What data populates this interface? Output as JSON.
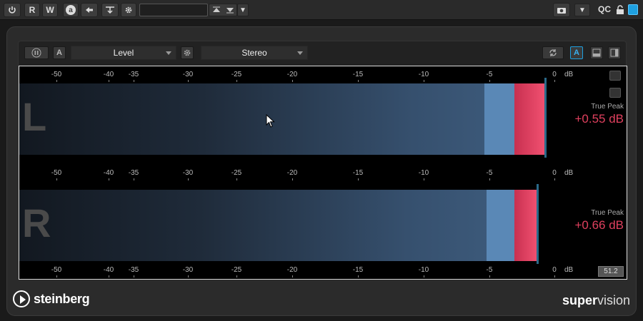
{
  "host_toolbar": {
    "power_icon": "power-icon",
    "read_label": "R",
    "write_label": "W",
    "automation_icon": "a",
    "preset_value": "",
    "qc_label": "QC"
  },
  "controls": {
    "mode_select": "Level",
    "channel_select": "Stereo",
    "auto_label": "A",
    "auto_right_label": "A"
  },
  "scale": {
    "ticks": [
      "-50",
      "-40",
      "-35",
      "-30",
      "-25",
      "-20",
      "-15",
      "-10",
      "-5",
      "0"
    ],
    "unit": "dB"
  },
  "channels": [
    {
      "letter": "L",
      "true_peak_label": "True Peak",
      "true_peak_value": "+0.55 dB",
      "level_fraction": 0.98,
      "red_start_db": -3.1,
      "light_start_db": -5.5
    },
    {
      "letter": "R",
      "true_peak_label": "True Peak",
      "true_peak_value": "+0.66 dB",
      "level_fraction": 0.965,
      "red_start_db": -3.1,
      "light_start_db": -5.3
    }
  ],
  "version_badge": "51.2",
  "brand": "steinberg",
  "product_bold": "super",
  "product_light": "vision",
  "colors": {
    "accent_blue": "#1ea0e0",
    "peak_red": "#e0405e",
    "meter_blue": "#5a88b6"
  }
}
